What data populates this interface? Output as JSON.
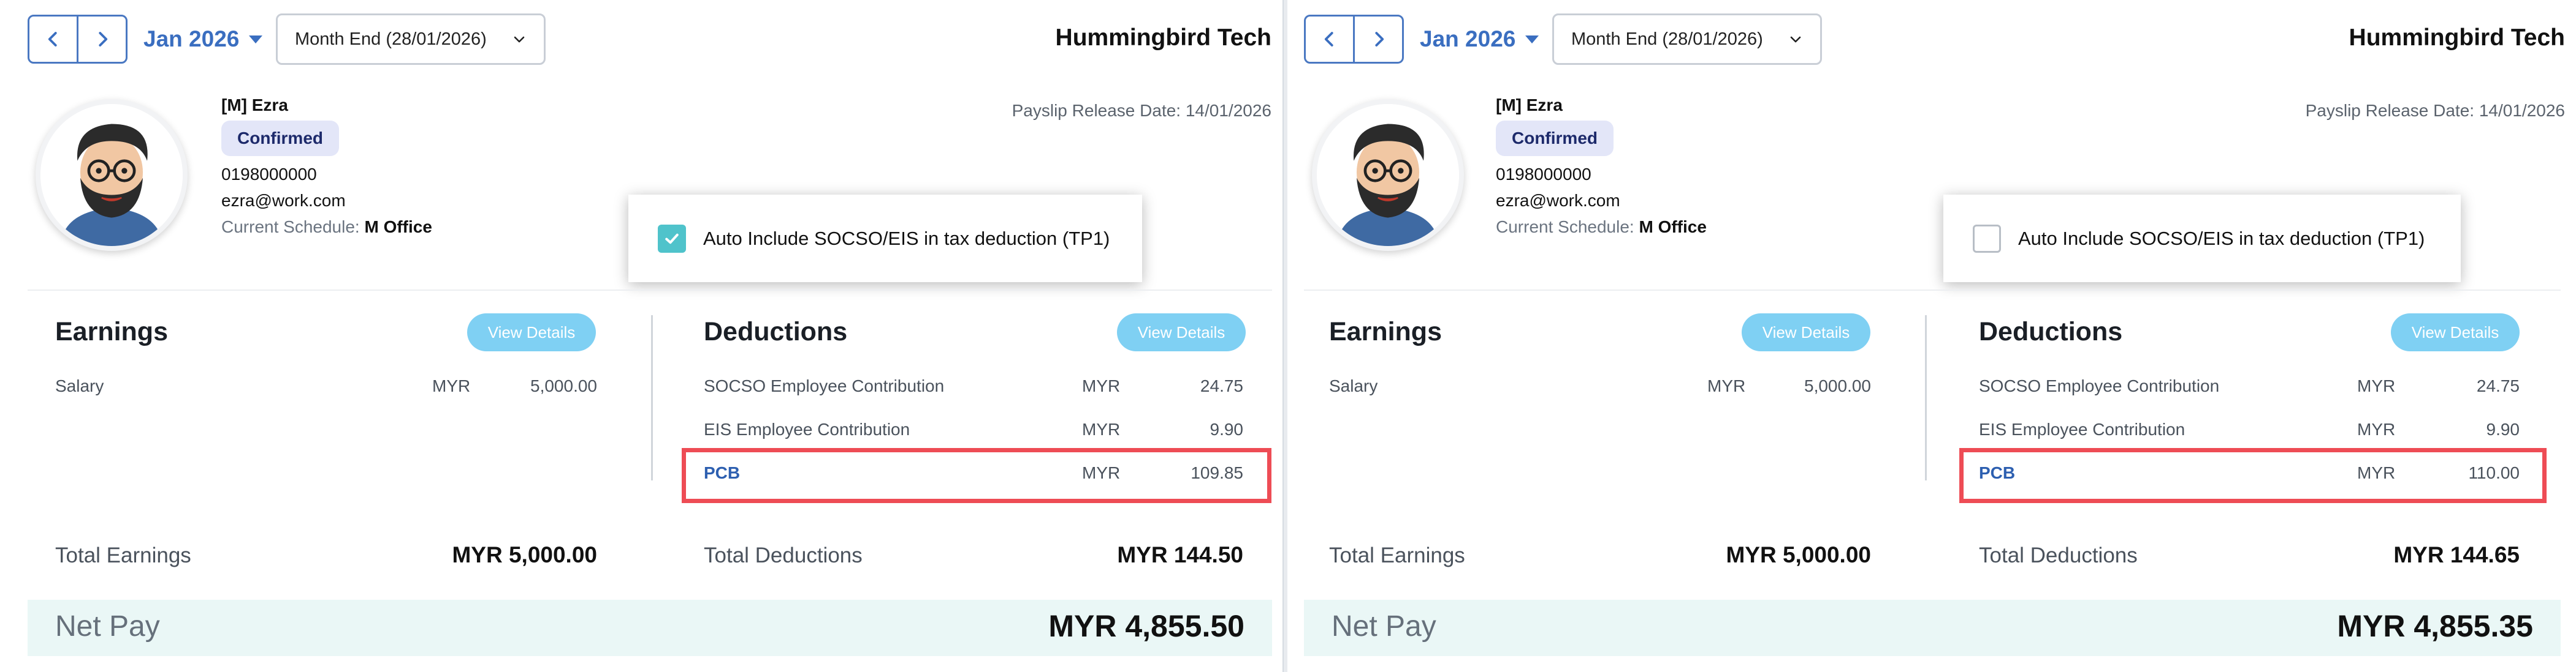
{
  "panels": [
    {
      "header": {
        "month": "Jan 2026",
        "period": "Month End (28/01/2026)",
        "company": "Hummingbird Tech"
      },
      "employee": {
        "name": "[M] Ezra",
        "status": "Confirmed",
        "phone": "0198000000",
        "email": "ezra@work.com",
        "schedule_label": "Current Schedule:",
        "schedule_value": "M Office"
      },
      "release_date": "Payslip Release Date: 14/01/2026",
      "popup": {
        "label": "Auto Include SOCSO/EIS in tax deduction (TP1)",
        "checked": true
      },
      "earnings": {
        "title": "Earnings",
        "view_label": "View Details",
        "rows": [
          {
            "label": "Salary",
            "currency": "MYR",
            "amount": "5,000.00"
          }
        ],
        "total_label": "Total Earnings",
        "total_value": "MYR 5,000.00"
      },
      "deductions": {
        "title": "Deductions",
        "view_label": "View Details",
        "rows": [
          {
            "label": "SOCSO Employee Contribution",
            "currency": "MYR",
            "amount": "24.75"
          },
          {
            "label": "EIS Employee Contribution",
            "currency": "MYR",
            "amount": "9.90"
          },
          {
            "label": "PCB",
            "currency": "MYR",
            "amount": "109.85"
          }
        ],
        "total_label": "Total Deductions",
        "total_value": "MYR 144.50"
      },
      "netpay": {
        "label": "Net Pay",
        "value": "MYR 4,855.50"
      }
    },
    {
      "header": {
        "month": "Jan 2026",
        "period": "Month End (28/01/2026)",
        "company": "Hummingbird Tech"
      },
      "employee": {
        "name": "[M] Ezra",
        "status": "Confirmed",
        "phone": "0198000000",
        "email": "ezra@work.com",
        "schedule_label": "Current Schedule:",
        "schedule_value": "M Office"
      },
      "release_date": "Payslip Release Date: 14/01/2026",
      "popup": {
        "label": "Auto Include SOCSO/EIS in tax deduction (TP1)",
        "checked": false
      },
      "earnings": {
        "title": "Earnings",
        "view_label": "View Details",
        "rows": [
          {
            "label": "Salary",
            "currency": "MYR",
            "amount": "5,000.00"
          }
        ],
        "total_label": "Total Earnings",
        "total_value": "MYR 5,000.00"
      },
      "deductions": {
        "title": "Deductions",
        "view_label": "View Details",
        "rows": [
          {
            "label": "SOCSO Employee Contribution",
            "currency": "MYR",
            "amount": "24.75"
          },
          {
            "label": "EIS Employee Contribution",
            "currency": "MYR",
            "amount": "9.90"
          },
          {
            "label": "PCB",
            "currency": "MYR",
            "amount": "110.00"
          }
        ],
        "total_label": "Total Deductions",
        "total_value": "MYR 144.65"
      },
      "netpay": {
        "label": "Net Pay",
        "value": "MYR 4,855.35"
      }
    }
  ],
  "colors": {
    "accent": "#3a6ec0",
    "teal_check": "#4fc3cb",
    "view_button": "#7fd0f3",
    "highlight": "#ee4c55",
    "netpay_bg": "#eaf7f6",
    "badge_bg": "#e3e6f8"
  }
}
